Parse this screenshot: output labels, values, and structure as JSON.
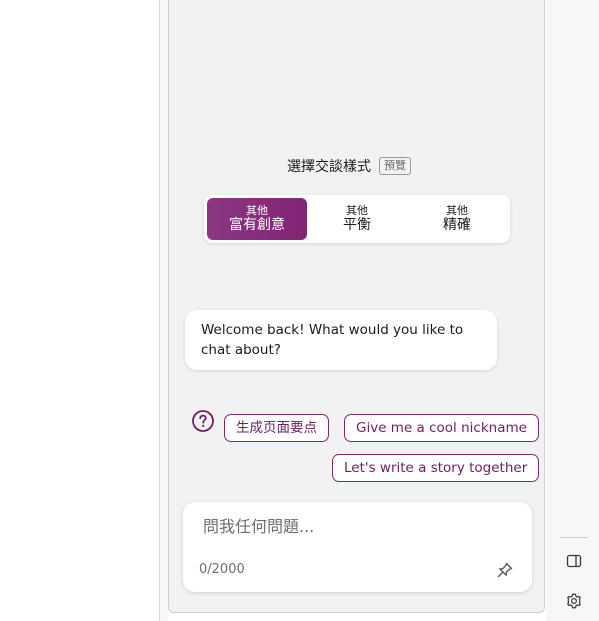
{
  "conversation_style": {
    "label": "選擇交談樣式",
    "badge": "預覽",
    "options": [
      {
        "small": "其他",
        "main": "富有創意",
        "selected": true
      },
      {
        "small": "其他",
        "main": "平衡",
        "selected": false
      },
      {
        "small": "其他",
        "main": "精確",
        "selected": false
      }
    ]
  },
  "welcome_message": "Welcome back! What would you like to chat about?",
  "suggestions": [
    "生成页面要点",
    "Give me a cool nickname",
    "Let's write a story together"
  ],
  "input": {
    "placeholder": "問我任何問題...",
    "value": "",
    "counter": "0/2000"
  },
  "icons": {
    "help": "question-circle-icon",
    "pin": "pin-icon",
    "sidebar_toggle": "sidebar-panel-icon",
    "settings": "gear-icon"
  },
  "colors": {
    "accent": "#822475",
    "panel_bg": "#f2f2f2"
  }
}
